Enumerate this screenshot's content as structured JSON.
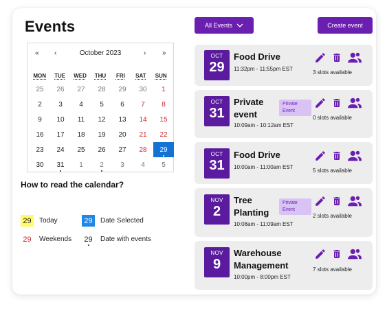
{
  "page": {
    "title": "Events"
  },
  "toolbar": {
    "filter_label": "All Events",
    "create_label": "Create event"
  },
  "calendar": {
    "month_label": "October 2023",
    "nav": {
      "prev_year": "«",
      "prev": "‹",
      "next": "›",
      "next_year": "»"
    },
    "weekdays": [
      "MON",
      "TUE",
      "WED",
      "THU",
      "FRI",
      "SAT",
      "SUN"
    ],
    "weeks": [
      [
        "25",
        "26",
        "27",
        "28",
        "29",
        "30",
        "1"
      ],
      [
        "2",
        "3",
        "4",
        "5",
        "6",
        "7",
        "8"
      ],
      [
        "9",
        "10",
        "11",
        "12",
        "13",
        "14",
        "15"
      ],
      [
        "16",
        "17",
        "18",
        "19",
        "20",
        "21",
        "22"
      ],
      [
        "23",
        "24",
        "25",
        "26",
        "27",
        "28",
        "29"
      ],
      [
        "30",
        "31",
        "1",
        "2",
        "3",
        "4",
        "5"
      ]
    ],
    "selected_day": "29"
  },
  "legend": {
    "title": "How to read the calendar?",
    "today": {
      "num": "29",
      "label": "Today"
    },
    "selected": {
      "num": "29",
      "label": "Date Selected"
    },
    "weekends": {
      "num": "29",
      "label": "Weekends"
    },
    "events": {
      "num": "29",
      "label": "Date with events"
    }
  },
  "events": [
    {
      "month": "OCT",
      "day": "29",
      "title": "Food Drive",
      "time": "11:32pm - 11:55pm EST",
      "slots": "3 slots available",
      "private": false
    },
    {
      "month": "OCT",
      "day": "31",
      "title": "Private event",
      "title_l1": "Private",
      "title_l2": "event",
      "time": "10:09am - 10:12am EST",
      "slots": "0 slots available",
      "private": true,
      "badge": "Private Event",
      "badge_l1": "Private",
      "badge_l2": "Event"
    },
    {
      "month": "OCT",
      "day": "31",
      "title": "Food Drive",
      "time": "10:00am - 11:00am EST",
      "slots": "5 slots available",
      "private": false
    },
    {
      "month": "NOV",
      "day": "2",
      "title": "Tree Planting",
      "title_l1": "Tree",
      "title_l2": "Planting",
      "time": "10:08am - 11:09am EST",
      "slots": "2 slots available",
      "private": true,
      "badge": "Private Event",
      "badge_l1": "Private",
      "badge_l2": "Event"
    },
    {
      "month": "NOV",
      "day": "9",
      "title": "Warehouse Management",
      "title_l1": "Warehouse",
      "title_l2": "Management",
      "time": "10:00pm - 8:00pm EST",
      "slots": "7 slots available",
      "private": false
    }
  ],
  "colors": {
    "accent": "#6a1fb0",
    "date_box": "#5b1b9e",
    "selected": "#1273d5",
    "today": "#fff96b",
    "weekend": "#d1242f",
    "badge_bg": "#d9c3f5"
  }
}
